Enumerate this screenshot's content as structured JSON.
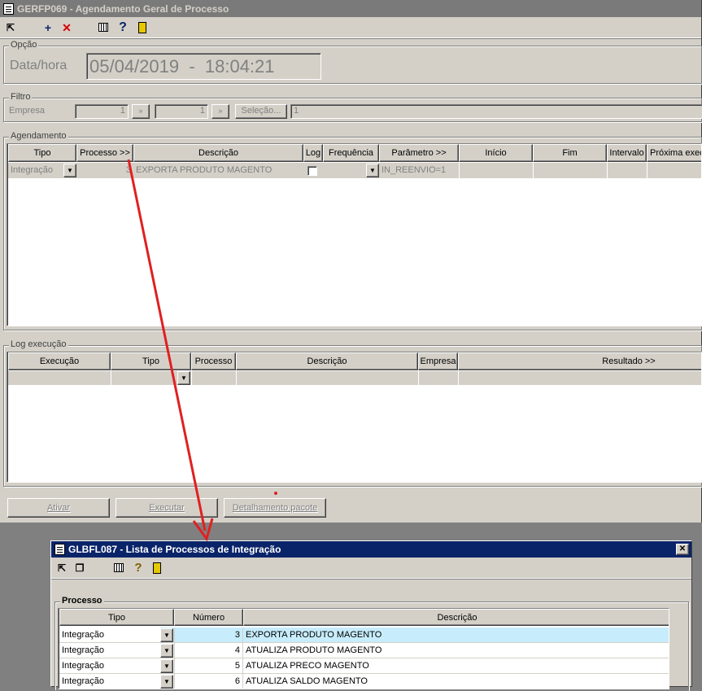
{
  "main_window": {
    "title": "GERFP069 - Agendamento Geral de Processo",
    "toolbar": {
      "add": "+",
      "delete": "✕",
      "help": "?"
    },
    "opcao": {
      "legend": "Opção",
      "label": "Data/hora",
      "value": "05/04/2019  -  18:04:21"
    },
    "filtro": {
      "legend": "Filtro",
      "empresa_label": "Empresa",
      "empresa_value1": "1",
      "empresa_value2": "1",
      "selecao_label": "Seleção...",
      "selecao_value": "1"
    },
    "agendamento": {
      "legend": "Agendamento",
      "headers": [
        "Tipo",
        "Processo >>",
        "Descrição",
        "Log",
        "Frequência",
        "Parâmetro >>",
        "Início",
        "Fim",
        "Intervalo",
        "Próxima exec"
      ],
      "row": {
        "tipo": "Integração",
        "processo": "3",
        "descricao": "EXPORTA PRODUTO MAGENTO",
        "parametro": "IN_REENVIO=1"
      }
    },
    "log": {
      "legend": "Log execução",
      "headers": [
        "Execução",
        "Tipo",
        "Processo",
        "Descrição",
        "Empresa",
        "Resultado >>"
      ]
    },
    "buttons": {
      "ativar": "Ativar",
      "executar": "Executar",
      "detalhamento": "Detalhamento pacote"
    }
  },
  "list_window": {
    "title": "GLBFL087 - Lista de Processos de Integração",
    "close": "✕",
    "help": "?",
    "processo": {
      "legend": "Processo",
      "headers": [
        "Tipo",
        "Número",
        "Descrição"
      ],
      "rows": [
        {
          "tipo": "Integração",
          "numero": "3",
          "descricao": "EXPORTA PRODUTO MAGENTO"
        },
        {
          "tipo": "Integração",
          "numero": "4",
          "descricao": "ATUALIZA PRODUTO MAGENTO"
        },
        {
          "tipo": "Integração",
          "numero": "5",
          "descricao": "ATUALIZA PRECO MAGENTO"
        },
        {
          "tipo": "Integração",
          "numero": "6",
          "descricao": "ATUALIZA SALDO MAGENTO"
        }
      ]
    }
  },
  "colors": {
    "annotation_arrow": "#e02020",
    "title_inactive": "#7a7a7a",
    "title_active": "#0a246a",
    "selected_row": "#c7ecfc"
  }
}
